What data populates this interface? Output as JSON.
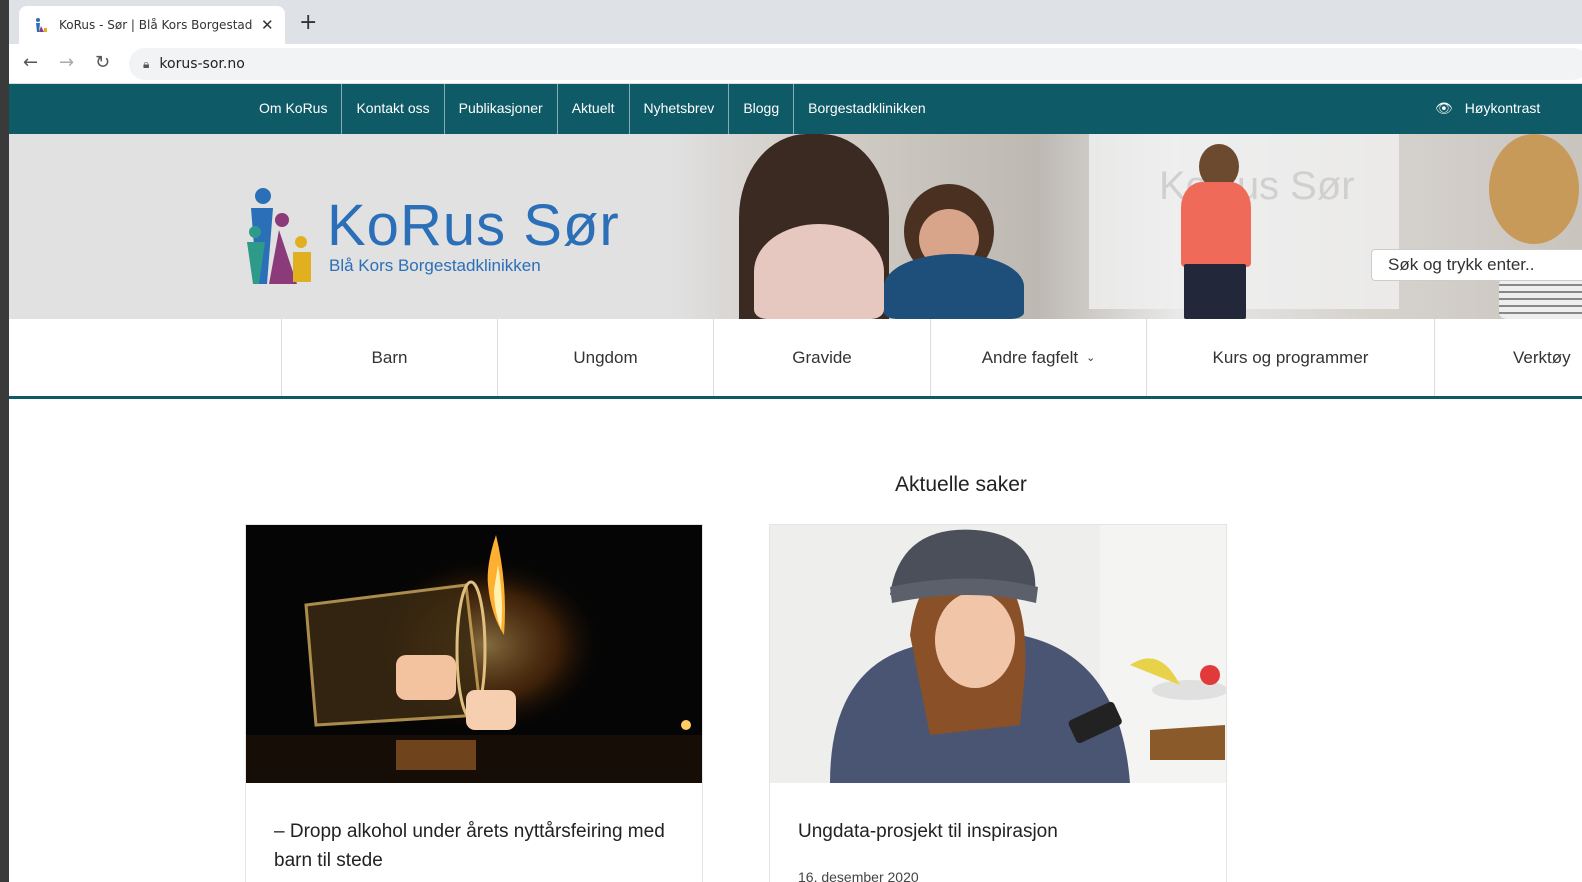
{
  "browser": {
    "tab_title": "KoRus - Sør | Blå Kors Borgestad",
    "url": "korus-sor.no"
  },
  "topnav": {
    "links": [
      "Om KoRus",
      "Kontakt oss",
      "Publikasjoner",
      "Aktuelt",
      "Nyhetsbrev",
      "Blogg",
      "Borgestadklinikken"
    ],
    "contrast_label": "Høykontrast"
  },
  "header": {
    "brand": "KoRus Sør",
    "brand_sub": "Blå Kors Borgestadklinikken",
    "search_placeholder": "Søk og trykk enter.."
  },
  "mainnav": {
    "items": [
      "Barn",
      "Ungdom",
      "Gravide",
      "Andre fagfelt",
      "Kurs og programmer",
      "Verktøy"
    ]
  },
  "content": {
    "section_title": "Aktuelle saker",
    "cards": [
      {
        "title": "– Dropp alkohol under årets nyttårsfeiring med barn til stede"
      },
      {
        "title": "Ungdata-prosjekt til inspirasjon",
        "date": "16. desember 2020"
      }
    ]
  },
  "colors": {
    "brand_teal": "#0e5a66",
    "brand_blue": "#2b6fb8"
  }
}
